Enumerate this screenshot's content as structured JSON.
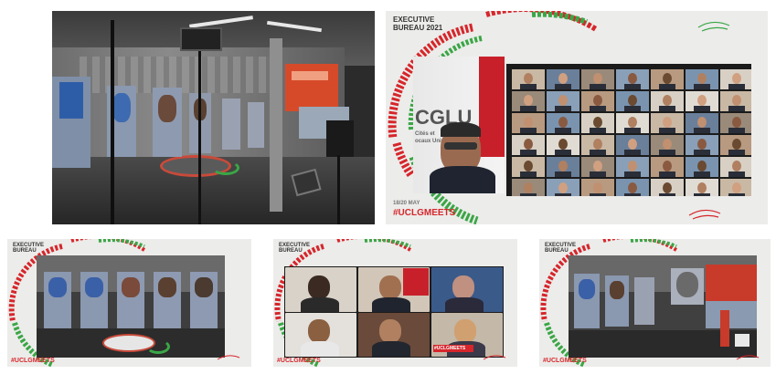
{
  "panel2": {
    "title_line1": "EXECUTIVE",
    "title_line2": "BUREAU 2021",
    "date": "18/20 MAY",
    "hashtag": "#UCLGMEETS",
    "logo_text": "CGLU",
    "logo_sub1": "Cités et",
    "logo_sub2": "ocaux Unis"
  },
  "panel3": {
    "title_line1": "EXECUTIVE",
    "title_line2": "BUREAU",
    "hashtag": "#UCLGMEETS"
  },
  "panel4": {
    "title_line1": "EXECUTIVE",
    "title_line2": "BUREAU",
    "hashtag": "#UCLGMEETS",
    "hashtag_overlay": "#UCLGMEETS"
  },
  "panel5": {
    "title_line1": "EXECUTIVE",
    "title_line2": "BUREAU",
    "hashtag": "#UCLGMEETS"
  },
  "colors": {
    "brand_red": "#d6262b",
    "brand_green": "#3aa646",
    "slide_bg": "#ececea"
  }
}
